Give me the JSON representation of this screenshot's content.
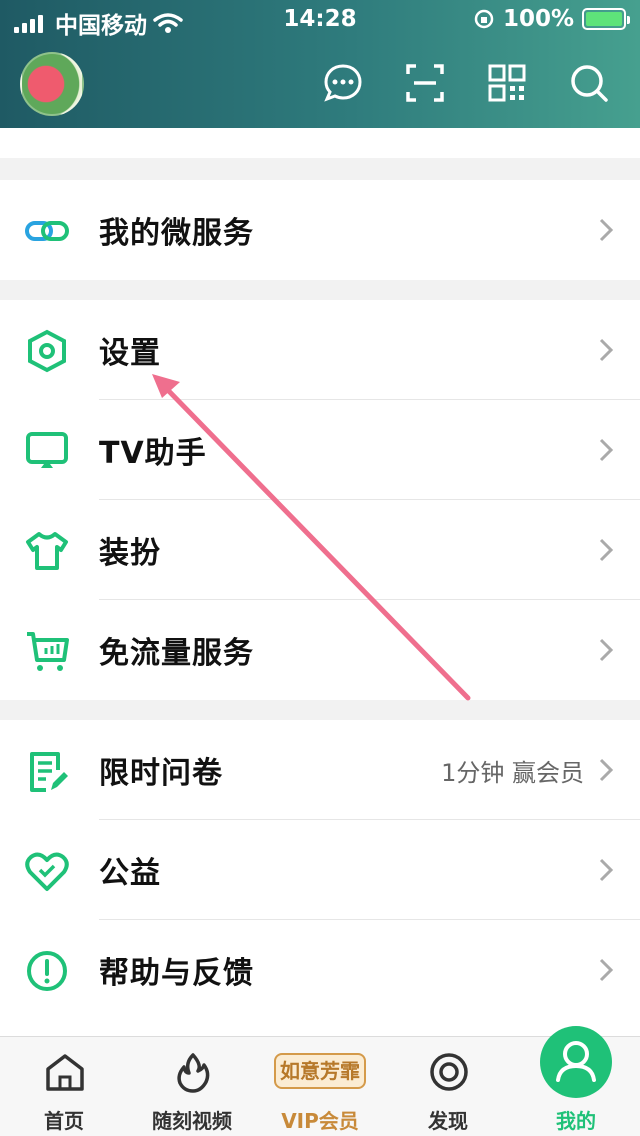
{
  "status_bar": {
    "carrier": "中国移动",
    "time": "14:28",
    "battery": "100%"
  },
  "header": {
    "icons": [
      "message-icon",
      "scan-icon",
      "qr-code-icon",
      "search-icon"
    ]
  },
  "menu": {
    "group1": [
      {
        "label": "我的微服务",
        "icon": "link-icon"
      }
    ],
    "group2": [
      {
        "label": "设置",
        "icon": "settings-hexagon-icon"
      },
      {
        "label": "TV助手",
        "icon": "tv-icon"
      },
      {
        "label": "装扮",
        "icon": "tshirt-icon"
      },
      {
        "label": "免流量服务",
        "icon": "cart-icon"
      }
    ],
    "group3": [
      {
        "label": "限时问卷",
        "extra": "1分钟 赢会员",
        "icon": "survey-icon"
      },
      {
        "label": "公益",
        "icon": "heart-icon"
      },
      {
        "label": "帮助与反馈",
        "icon": "help-icon"
      }
    ]
  },
  "tabbar": {
    "tabs": [
      {
        "label": "首页",
        "icon": "home-icon"
      },
      {
        "label": "随刻视频",
        "icon": "flame-icon"
      },
      {
        "label": "VIP会员",
        "badge": "如意芳霏",
        "icon": "vip-badge"
      },
      {
        "label": "发现",
        "icon": "discover-icon"
      },
      {
        "label": "我的",
        "icon": "me-icon"
      }
    ]
  },
  "colors": {
    "accent": "#1fc178",
    "header_start": "#1f5a64",
    "header_end": "#46a08f",
    "vip_gold": "#d49a4a"
  }
}
